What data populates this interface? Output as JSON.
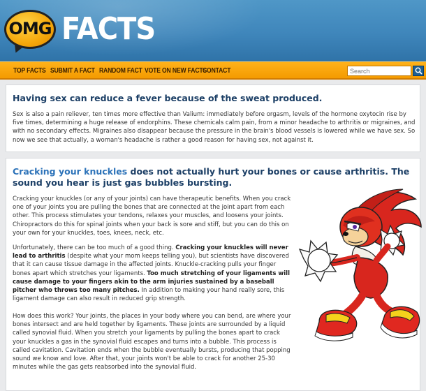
{
  "header": {
    "logo_bubble_text": "OMG",
    "logo_text": "FACTS"
  },
  "nav": {
    "items": [
      "TOP FACTS",
      "SUBMIT A FACT",
      "RANDOM FACT",
      "VOTE ON NEW FACTS",
      "CONTACT"
    ],
    "search_placeholder": "Search"
  },
  "facts": [
    {
      "title": "Having sex can reduce a fever because of the sweat produced.",
      "body": "Sex is also a pain reliever, ten times more effective than Valium: immediately before orgasm, levels of the hormone oxytocin rise by five times, determining a huge release of endorphins. These chemicals calm pain, from a minor headache to arthritis or migraines, and with no secondary effects. Migraines also disappear because the pressure in the brain's blood vessels is lowered while we have sex. So now we see that actually, a woman's headache is rather a good reason for having sex, not against it."
    },
    {
      "title_link": "Cracking your knuckles",
      "title_rest": " does not actually hurt your bones or cause arthritis. The sound you hear is just gas bubbles bursting.",
      "para1": "Cracking your knuckles (or any of your joints) can have therapeutic benefits. When you crack one of your joints you are pulling the bones that are connected at the joint apart from each other. This process stimulates your tendons, relaxes your muscles, and loosens your joints. Chiropractors do this for spinal joints when your back is sore and stiff, but you can do this on your own for your knuckles, toes, knees, neck, etc.",
      "para2_a": "Unfortunately, there can be too much of a good thing. ",
      "para2_b": "Cracking your knuckles will never lead to arthritis",
      "para2_c": " (despite what your mom keeps telling you), but scientists have discovered that it can cause tissue damage in the affected joints. Knuckle-cracking pulls your finger bones apart which stretches your ligaments. ",
      "para2_d": "Too much stretching of your ligaments will cause damage to your fingers akin to the arm injuries sustained by a baseball pitcher who throws too many pitches.",
      "para2_e": " In addition to making your hand really sore, this ligament damage can also result in reduced grip strength.",
      "para3": "How does this work? Your joints, the places in your body where you can bend, are where your bones intersect and are held together by ligaments. These joints are surrounded by a liquid called synovial fluid. When you stretch your ligaments by pulling the bones apart to crack your knuckles a gas in the synovial fluid escapes and turns into a bubble. This process is called cavitation. Cavitation ends when the bubble eventually bursts, producing that popping sound we know and love. After that, your joints won't be able to crack for another 25-30 minutes while the gas gets reabsorbed into the synovial fluid."
    }
  ]
}
